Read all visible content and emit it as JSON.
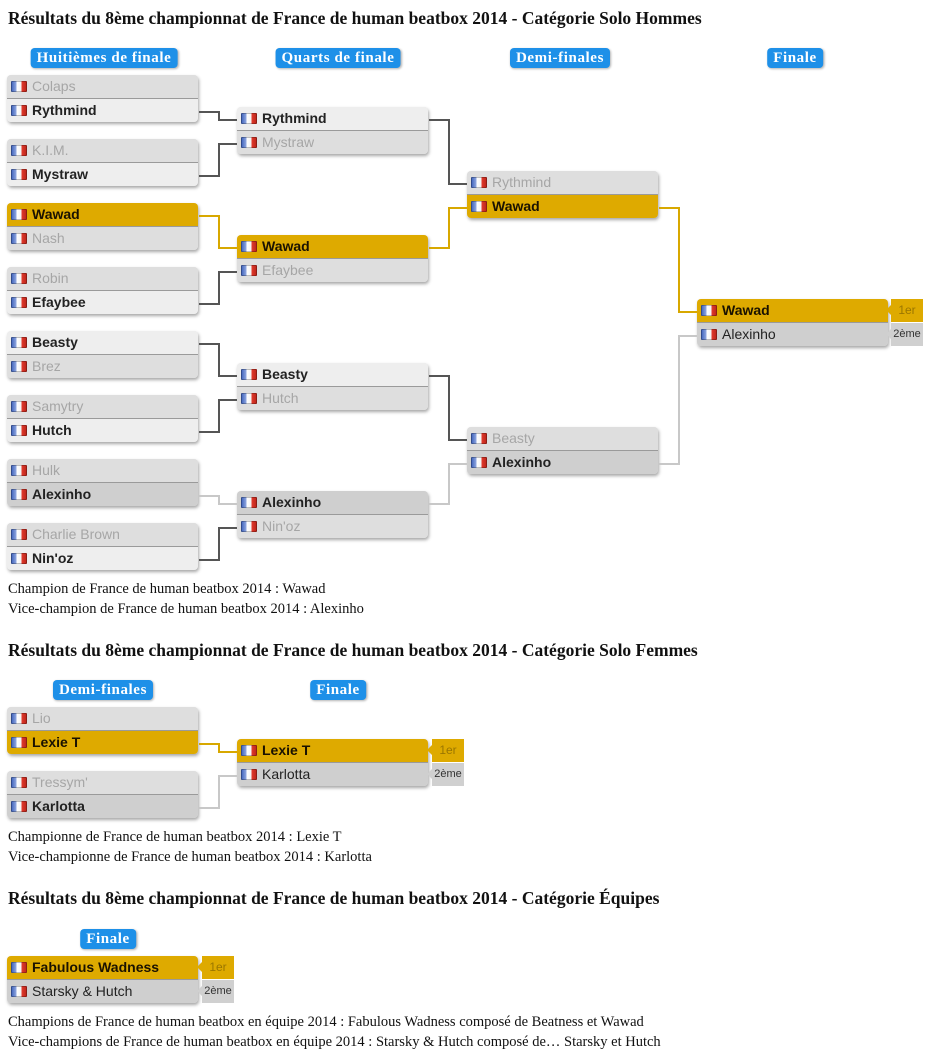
{
  "sections": [
    {
      "title": "Résultats du 8ème championnat de France de human beatbox 2014 - Catégorie Solo Hommes",
      "rounds": [
        "Huitièmes de finale",
        "Quarts de finale",
        "Demi-finales",
        "Finale"
      ],
      "matches": {
        "r1": [
          {
            "p1": "Colaps",
            "p2": "Rythmind",
            "winner": 2
          },
          {
            "p1": "K.I.M.",
            "p2": "Mystraw",
            "winner": 2
          },
          {
            "p1": "Wawad",
            "p2": "Nash",
            "winner": 1
          },
          {
            "p1": "Robin",
            "p2": "Efaybee",
            "winner": 2
          },
          {
            "p1": "Beasty",
            "p2": "Brez",
            "winner": 1
          },
          {
            "p1": "Samytry",
            "p2": "Hutch",
            "winner": 2
          },
          {
            "p1": "Hulk",
            "p2": "Alexinho",
            "winner": 2
          },
          {
            "p1": "Charlie Brown",
            "p2": "Nin'oz",
            "winner": 2
          }
        ],
        "r2": [
          {
            "p1": "Rythmind",
            "p2": "Mystraw",
            "winner": 1
          },
          {
            "p1": "Wawad",
            "p2": "Efaybee",
            "winner": 1
          },
          {
            "p1": "Beasty",
            "p2": "Hutch",
            "winner": 1
          },
          {
            "p1": "Alexinho",
            "p2": "Nin'oz",
            "winner": 1
          }
        ],
        "r3": [
          {
            "p1": "Rythmind",
            "p2": "Wawad",
            "winner": 2
          },
          {
            "p1": "Beasty",
            "p2": "Alexinho",
            "winner": 2
          }
        ],
        "final": {
          "p1": "Wawad",
          "p2": "Alexinho",
          "winner": 1
        }
      },
      "results": [
        "Champion de France de human beatbox 2014 : Wawad",
        "Vice-champion de France de human beatbox 2014 : Alexinho"
      ]
    },
    {
      "title": "Résultats du 8ème championnat de France de human beatbox 2014 - Catégorie Solo Femmes",
      "rounds": [
        "Demi-finales",
        "Finale"
      ],
      "matches": {
        "r1": [
          {
            "p1": "Lio",
            "p2": "Lexie T",
            "winner": 2
          },
          {
            "p1": "Tressym'",
            "p2": "Karlotta",
            "winner": 2
          }
        ],
        "final": {
          "p1": "Lexie T",
          "p2": "Karlotta",
          "winner": 1
        }
      },
      "results": [
        "Championne de France de human beatbox 2014 : Lexie T",
        "Vice-championne de France de human beatbox 2014 : Karlotta"
      ]
    },
    {
      "title": "Résultats du 8ème championnat de France de human beatbox 2014 - Catégorie Équipes",
      "rounds": [
        "Finale"
      ],
      "matches": {
        "final": {
          "p1": "Fabulous Wadness",
          "p2": "Starsky & Hutch",
          "winner": 1
        }
      },
      "results": [
        "Champions de France de human beatbox en équipe 2014 : Fabulous Wadness composé de Beatness et Wawad",
        "Vice-champions de France de human beatbox en équipe 2014 : Starsky & Hutch composé de… Starsky et Hutch"
      ]
    }
  ],
  "badges": {
    "first": "1er",
    "second": "2ème"
  },
  "colors": {
    "gold": "#deaa00",
    "tag_blue": "#1e90e8",
    "silver": "#cfcfcf"
  }
}
